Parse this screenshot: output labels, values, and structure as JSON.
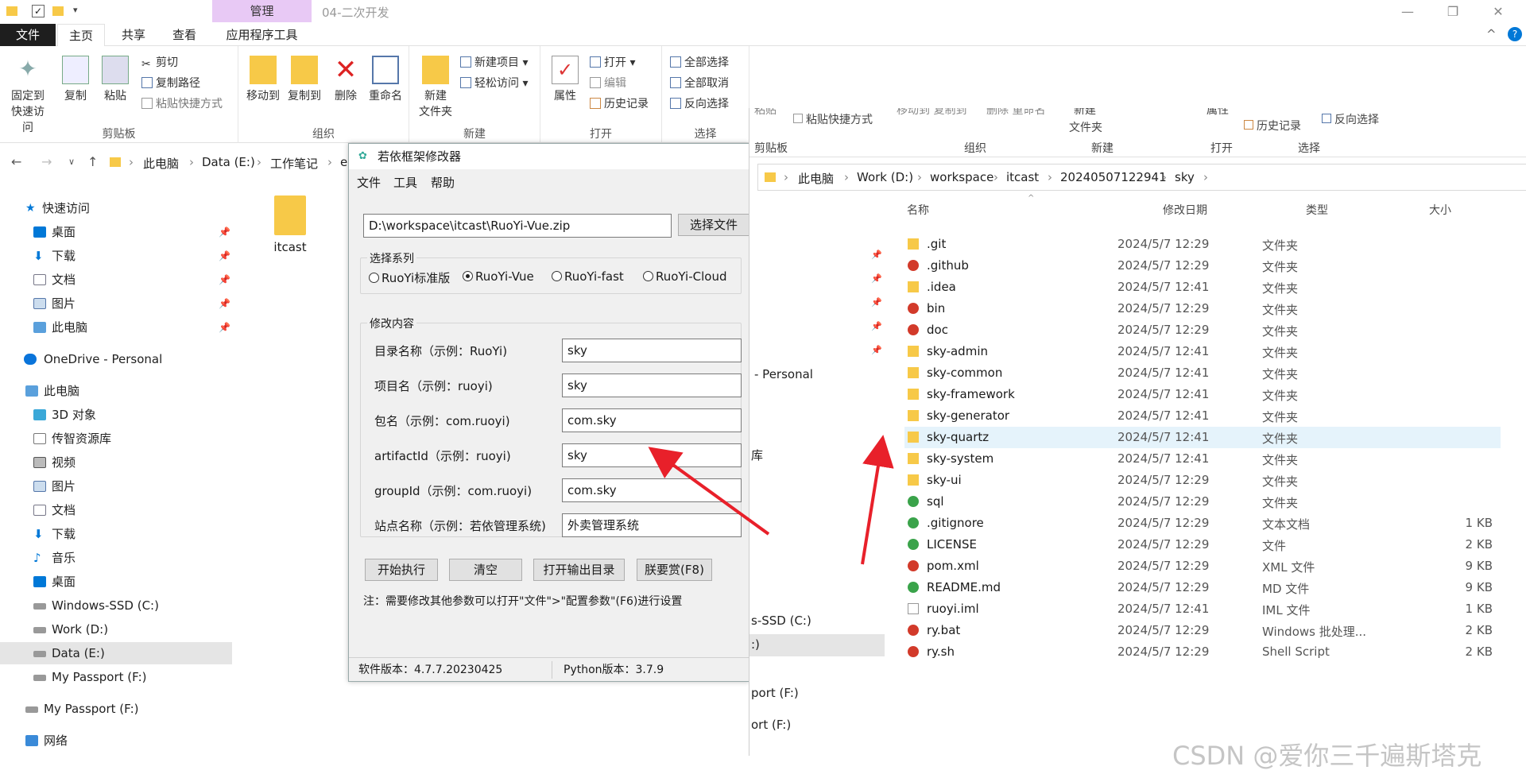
{
  "titlebar": {
    "context_tab": "管理",
    "window_title": "04-二次开发"
  },
  "tabs": [
    {
      "label": "文件"
    },
    {
      "label": "主页"
    },
    {
      "label": "共享"
    },
    {
      "label": "查看"
    },
    {
      "label": "应用程序工具"
    }
  ],
  "ribbon": {
    "pin": "固定到",
    "pin2": "快速访问",
    "copy": "复制",
    "paste": "粘贴",
    "cut": "剪切",
    "copy_path": "复制路径",
    "paste_shortcut": "粘贴快捷方式",
    "move_to": "移动到",
    "copy_to": "复制到",
    "delete": "删除",
    "rename": "重命名",
    "new_folder": "新建",
    "new_folder2": "文件夹",
    "new_item": "新建项目",
    "easy_access": "轻松访问",
    "properties": "属性",
    "open": "打开",
    "edit": "编辑",
    "history": "历史记录",
    "select_all": "全部选择",
    "select_none": "全部取消",
    "invert": "反向选择",
    "group_clipboard": "剪贴板",
    "group_organize": "组织",
    "group_new": "新建",
    "group_open": "打开",
    "group_select": "选择"
  },
  "address1": [
    "此电脑",
    "Data (E:)",
    "工作笔记",
    "e"
  ],
  "nav": [
    {
      "label": "快速访问"
    },
    {
      "label": "桌面"
    },
    {
      "label": "下载"
    },
    {
      "label": "文档"
    },
    {
      "label": "图片"
    },
    {
      "label": "此电脑"
    },
    {
      "label": "OneDrive - Personal"
    },
    {
      "label": "此电脑"
    },
    {
      "label": "3D 对象"
    },
    {
      "label": "传智资源库"
    },
    {
      "label": "视频"
    },
    {
      "label": "图片"
    },
    {
      "label": "文档"
    },
    {
      "label": "下载"
    },
    {
      "label": "音乐"
    },
    {
      "label": "桌面"
    },
    {
      "label": "Windows-SSD (C:)"
    },
    {
      "label": "Work (D:)"
    },
    {
      "label": "Data (E:)"
    },
    {
      "label": "My Passport (F:)"
    },
    {
      "label": "My Passport (F:)"
    },
    {
      "label": "网络"
    }
  ],
  "bg_folder": "itcast",
  "dialog": {
    "title": "若依框架修改器",
    "menu": [
      "文件",
      "工具",
      "帮助"
    ],
    "path_value": "D:\\workspace\\itcast\\RuoYi-Vue.zip",
    "choose_file": "选择文件",
    "series_title": "选择系列",
    "series": [
      "RuoYi标准版",
      "RuoYi-Vue",
      "RuoYi-fast",
      "RuoYi-Cloud"
    ],
    "modify_title": "修改内容",
    "fields": [
      {
        "label": "目录名称（示例：RuoYi)",
        "value": "sky"
      },
      {
        "label": "项目名（示例：ruoyi)",
        "value": "sky"
      },
      {
        "label": "包名（示例：com.ruoyi)",
        "value": "com.sky"
      },
      {
        "label": "artifactId（示例：ruoyi)",
        "value": "sky"
      },
      {
        "label": "groupId（示例：com.ruoyi)",
        "value": "com.sky"
      },
      {
        "label": "站点名称（示例：若依管理系统)",
        "value": "外卖管理系统"
      }
    ],
    "buttons": [
      "开始执行",
      "清空",
      "打开输出目录",
      "朕要赏(F8)"
    ],
    "note": "注：需要修改其他参数可以打开\"文件\">\"配置参数\"(F6)进行设置",
    "version": "软件版本：4.7.7.20230425",
    "python": "Python版本：3.7.9"
  },
  "explorer2": {
    "ribbon_partial": {
      "paste": "粘贴",
      "paste_shortcut": "粘贴快捷方式",
      "move_copy": "移动到 复制到",
      "delete_rename": "删除  重命名",
      "new": "新建",
      "new_folder": "文件夹",
      "props": "属性",
      "history": "历史记录",
      "invert": "反向选择",
      "g_clipboard": "剪贴板",
      "g_organize": "组织",
      "g_new": "新建",
      "g_open": "打开",
      "g_select": "选择"
    },
    "address": [
      "此电脑",
      "Work (D:)",
      "workspace",
      "itcast",
      "20240507122941",
      "sky"
    ],
    "columns": {
      "name": "名称",
      "date": "修改日期",
      "type": "类型",
      "size": "大小"
    },
    "nav_partial": [
      "- Personal",
      "库",
      "s-SSD (C:)",
      ":)",
      "port (F:)",
      "ort (F:)"
    ],
    "files": [
      {
        "name": ".git",
        "date": "2024/5/7 12:29",
        "type": "文件夹",
        "size": "",
        "icon": "folder"
      },
      {
        "name": ".github",
        "date": "2024/5/7 12:29",
        "type": "文件夹",
        "size": "",
        "icon": "git-red"
      },
      {
        "name": ".idea",
        "date": "2024/5/7 12:41",
        "type": "文件夹",
        "size": "",
        "icon": "folder"
      },
      {
        "name": "bin",
        "date": "2024/5/7 12:29",
        "type": "文件夹",
        "size": "",
        "icon": "git-red"
      },
      {
        "name": "doc",
        "date": "2024/5/7 12:29",
        "type": "文件夹",
        "size": "",
        "icon": "git-red"
      },
      {
        "name": "sky-admin",
        "date": "2024/5/7 12:41",
        "type": "文件夹",
        "size": "",
        "icon": "folder"
      },
      {
        "name": "sky-common",
        "date": "2024/5/7 12:41",
        "type": "文件夹",
        "size": "",
        "icon": "folder"
      },
      {
        "name": "sky-framework",
        "date": "2024/5/7 12:41",
        "type": "文件夹",
        "size": "",
        "icon": "folder"
      },
      {
        "name": "sky-generator",
        "date": "2024/5/7 12:41",
        "type": "文件夹",
        "size": "",
        "icon": "folder"
      },
      {
        "name": "sky-quartz",
        "date": "2024/5/7 12:41",
        "type": "文件夹",
        "size": "",
        "icon": "folder"
      },
      {
        "name": "sky-system",
        "date": "2024/5/7 12:41",
        "type": "文件夹",
        "size": "",
        "icon": "folder"
      },
      {
        "name": "sky-ui",
        "date": "2024/5/7 12:29",
        "type": "文件夹",
        "size": "",
        "icon": "folder"
      },
      {
        "name": "sql",
        "date": "2024/5/7 12:29",
        "type": "文件夹",
        "size": "",
        "icon": "git-green"
      },
      {
        "name": ".gitignore",
        "date": "2024/5/7 12:29",
        "type": "文本文档",
        "size": "1 KB",
        "icon": "git-green"
      },
      {
        "name": "LICENSE",
        "date": "2024/5/7 12:29",
        "type": "文件",
        "size": "2 KB",
        "icon": "git-green"
      },
      {
        "name": "pom.xml",
        "date": "2024/5/7 12:29",
        "type": "XML 文件",
        "size": "9 KB",
        "icon": "git-red"
      },
      {
        "name": "README.md",
        "date": "2024/5/7 12:29",
        "type": "MD 文件",
        "size": "9 KB",
        "icon": "git-green"
      },
      {
        "name": "ruoyi.iml",
        "date": "2024/5/7 12:41",
        "type": "IML 文件",
        "size": "1 KB",
        "icon": "file"
      },
      {
        "name": "ry.bat",
        "date": "2024/5/7 12:29",
        "type": "Windows 批处理...",
        "size": "2 KB",
        "icon": "git-red"
      },
      {
        "name": "ry.sh",
        "date": "2024/5/7 12:29",
        "type": "Shell Script",
        "size": "2 KB",
        "icon": "git-red"
      }
    ]
  },
  "watermark": "CSDN @爱你三千遍斯塔克",
  "colors": {
    "accent": "#0078d7",
    "folder": "#f7c948",
    "arrow": "#e8202a",
    "context_tab": "#e8c9f5"
  }
}
